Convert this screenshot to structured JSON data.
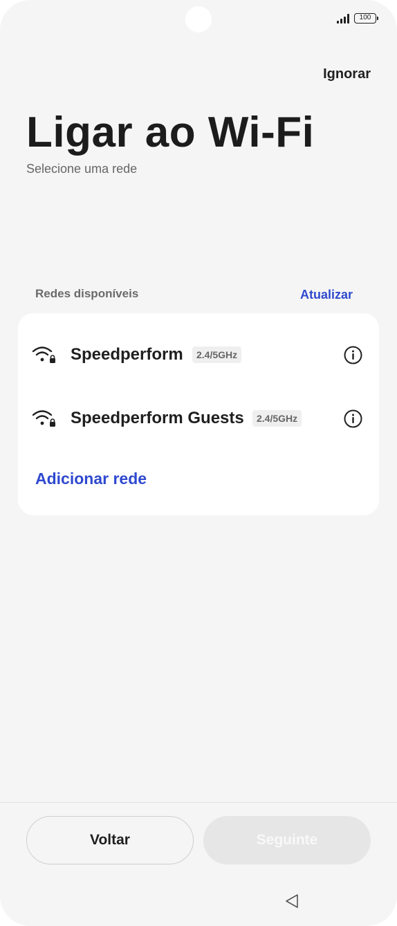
{
  "status_bar": {
    "battery": "100"
  },
  "header": {
    "skip_label": "Ignorar"
  },
  "main": {
    "title": "Ligar ao Wi-Fi",
    "subtitle": "Selecione uma rede",
    "section_label": "Redes disponíveis",
    "refresh_label": "Atualizar"
  },
  "networks": [
    {
      "name": "Speedperform",
      "band": "2.4/5GHz",
      "icon": "wifi-locked-icon"
    },
    {
      "name": "Speedperform Guests",
      "band": "2.4/5GHz",
      "icon": "wifi-locked-icon"
    }
  ],
  "add_network_label": "Adicionar rede",
  "footer": {
    "back_label": "Voltar",
    "next_label": "Seguinte"
  },
  "colors": {
    "accent": "#2f49cf",
    "background": "#f5f5f5",
    "card": "#ffffff"
  }
}
